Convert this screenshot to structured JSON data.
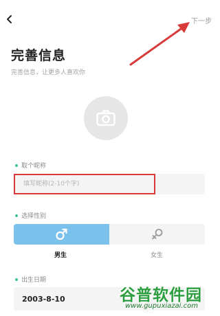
{
  "header": {
    "next_label": "下一步"
  },
  "page": {
    "title": "完善信息",
    "subtitle": "完善信息，让更多人喜欢你"
  },
  "nickname": {
    "label": "取个昵称",
    "placeholder": "填写昵称(2-10个字)",
    "value": ""
  },
  "gender": {
    "label": "选择性别",
    "options": [
      "男生",
      "女生"
    ],
    "selected": "男生"
  },
  "birth": {
    "label": "出生日期",
    "value": "2003-8-10"
  },
  "watermark": {
    "logo_text": "谷普软件园",
    "url": "www.gupuxiazai.com"
  },
  "colors": {
    "accent_dot": "#3fc49a",
    "male_selected": "#7ac2ec",
    "annotation_red": "#d83a3a",
    "watermark_green": "#2d9e3f"
  },
  "icons": {
    "back": "chevron-left-icon",
    "avatar": "camera-icon",
    "male": "male-symbol-icon",
    "female": "female-symbol-icon"
  }
}
